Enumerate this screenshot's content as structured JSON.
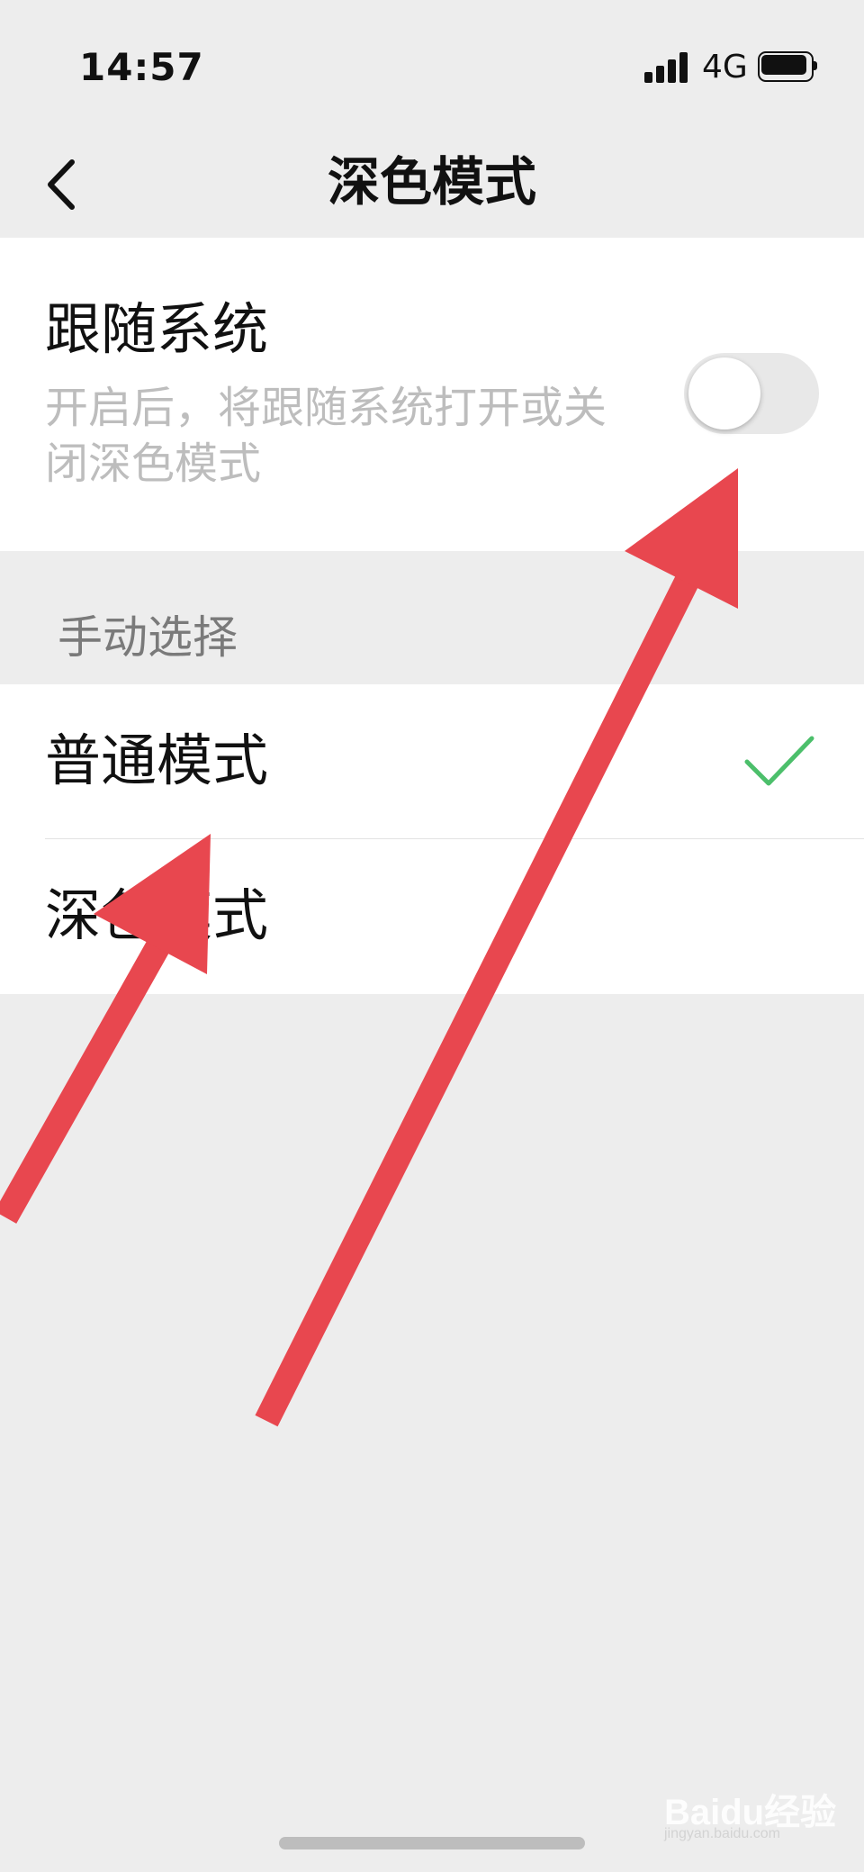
{
  "status_bar": {
    "time": "14:57",
    "network": "4G",
    "icons": [
      "signal-icon",
      "battery-icon"
    ]
  },
  "nav": {
    "title": "深色模式",
    "back_icon": "chevron-left-icon"
  },
  "follow_system": {
    "title": "跟随系统",
    "description": "开启后，将跟随系统打开或关闭深色模式",
    "toggle_on": false
  },
  "manual": {
    "section_label": "手动选择",
    "options": [
      {
        "label": "普通模式",
        "selected": true
      },
      {
        "label": "深色模式",
        "selected": false
      }
    ]
  },
  "watermark": {
    "brand": "Baidu经验",
    "url": "jingyan.baidu.com"
  },
  "colors": {
    "background": "#ededed",
    "card": "#ffffff",
    "check": "#4cbf6b",
    "annotation_arrow": "#e8474f"
  }
}
